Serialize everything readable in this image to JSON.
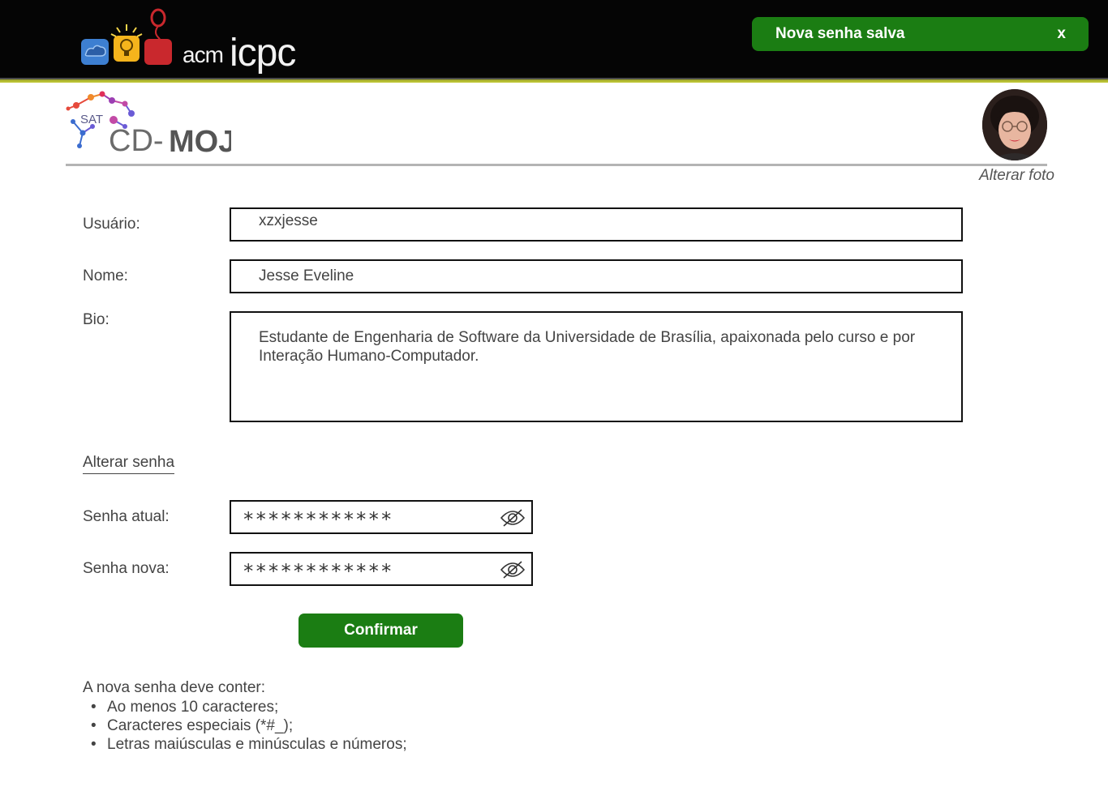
{
  "header": {
    "logo_acm": "acm",
    "logo_icpc": "icpc",
    "colors": {
      "background": "#050505",
      "accent": "#c7cf3b"
    }
  },
  "toast": {
    "message": "Nova senha salva",
    "close_label": "x",
    "color": "#1b7d13"
  },
  "brand": {
    "sat": "SAT",
    "name_light": "CD-",
    "name_bold": "MOJ"
  },
  "profile": {
    "change_photo_label": "Alterar foto"
  },
  "form": {
    "username": {
      "label": "Usuário:",
      "value": "xzxjesse"
    },
    "name": {
      "label": "Nome:",
      "value": "Jesse Eveline"
    },
    "bio": {
      "label": "Bio:",
      "value": "Estudante de Engenharia de Software da Universidade de Brasília, apaixonada pelo curso e por Interação Humano-Computador."
    }
  },
  "password": {
    "section_link": "Alterar senha",
    "current": {
      "label": "Senha atual:",
      "value": "************",
      "icon": "eye-slash-icon"
    },
    "new": {
      "label": "Senha nova:",
      "value": "************",
      "icon": "eye-slash-icon"
    },
    "confirm_label": "Confirmar",
    "rules_title": "A nova senha deve conter:",
    "rules": [
      "Ao menos 10 caracteres;",
      "Caracteres especiais (*#_);",
      "Letras maiúsculas e minúsculas e números;"
    ]
  }
}
